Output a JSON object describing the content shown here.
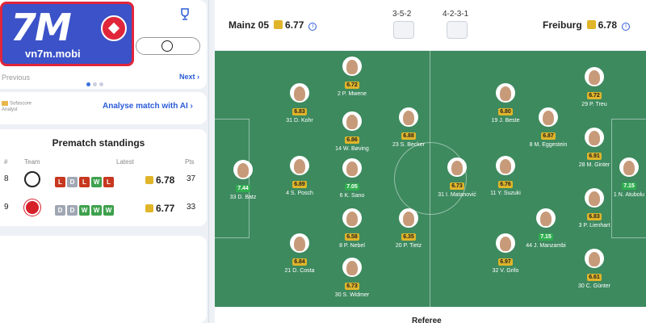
{
  "watermark": {
    "logo_text": "7M",
    "site": "vn7m.mobi"
  },
  "carousel": {
    "prev": "Previous",
    "next": "Next"
  },
  "analyst": {
    "logo_line1": "Sofascore",
    "logo_line2": "Analyst",
    "cta": "Analyse match with AI"
  },
  "standings": {
    "title": "Prematch standings",
    "headers": {
      "pos": "#",
      "team": "Team",
      "latest": "Latest",
      "pts": "Pts"
    },
    "rows": [
      {
        "pos": "8",
        "form": [
          "L",
          "D",
          "L",
          "W",
          "L"
        ],
        "rating": "6.78",
        "pts": "37",
        "crest_color": "#ffffff"
      },
      {
        "pos": "9",
        "form": [
          "D",
          "D",
          "W",
          "W",
          "W"
        ],
        "rating": "6.77",
        "pts": "33",
        "crest_color": "#d6202a"
      }
    ]
  },
  "match": {
    "home": {
      "name": "Mainz 05",
      "rating": "6.77",
      "formation": "3-5-2"
    },
    "away": {
      "name": "Freiburg",
      "rating": "6.78",
      "formation": "4-2-3-1"
    }
  },
  "players": [
    {
      "name": "33 D. Batz",
      "rating": "7.44",
      "tone": "g"
    },
    {
      "name": "31 D. Kohr",
      "rating": "6.83",
      "tone": "y"
    },
    {
      "name": "4 S. Posch",
      "rating": "6.89",
      "tone": "y"
    },
    {
      "name": "21 D. Costa",
      "rating": "6.84",
      "tone": "y"
    },
    {
      "name": "2 P. Mwene",
      "rating": "6.72",
      "tone": "y"
    },
    {
      "name": "14 W. Bøving",
      "rating": "6.86",
      "tone": "y"
    },
    {
      "name": "6 K. Sano",
      "rating": "7.05",
      "tone": "g"
    },
    {
      "name": "8 P. Nebel",
      "rating": "6.58",
      "tone": "y"
    },
    {
      "name": "30 S. Widmer",
      "rating": "6.73",
      "tone": "y"
    },
    {
      "name": "23 S. Becker",
      "rating": "6.88",
      "tone": "y"
    },
    {
      "name": "20 P. Tietz",
      "rating": "6.35",
      "tone": "y"
    },
    {
      "name": "31 I. Matanović",
      "rating": "6.73",
      "tone": "y"
    },
    {
      "name": "19 J. Beste",
      "rating": "6.80",
      "tone": "y"
    },
    {
      "name": "11 Y. Suzuki",
      "rating": "6.76",
      "tone": "y"
    },
    {
      "name": "44 J. Manzambi",
      "rating": "7.15",
      "tone": "g"
    },
    {
      "name": "32 V. Grifo",
      "rating": "6.97",
      "tone": "y"
    },
    {
      "name": "8 M. Eggestein",
      "rating": "6.87",
      "tone": "y"
    },
    {
      "name": "29 P. Treu",
      "rating": "6.72",
      "tone": "y"
    },
    {
      "name": "28 M. Ginter",
      "rating": "6.91",
      "tone": "y"
    },
    {
      "name": "3 P. Lienhart",
      "rating": "6.83",
      "tone": "y"
    },
    {
      "name": "30 C. Günter",
      "rating": "6.61",
      "tone": "y"
    },
    {
      "name": "1 N. Atubolu",
      "rating": "7.15",
      "tone": "g"
    }
  ],
  "footer": {
    "referee": "Referee"
  },
  "colors": {
    "pitch": "#3d8a5f",
    "accent": "#2a5bd7",
    "rating_gold": "#e0b52a"
  }
}
